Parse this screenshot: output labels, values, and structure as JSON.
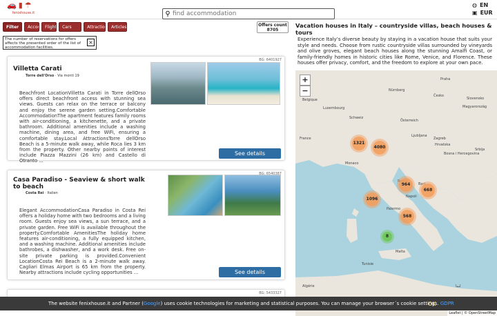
{
  "header": {
    "site_name": "fenixhouse.it",
    "search_placeholder": "find accommodation",
    "lang": "EN",
    "currency": "EUR"
  },
  "filters": [
    "Filter",
    "Accom",
    "Flights",
    "Cars",
    "Attractions",
    "Articles"
  ],
  "offers_count": {
    "label": "Offers count",
    "value": "8705"
  },
  "notice": {
    "text": "The number of reservations for offers affects the presented order of the list of accommodation facilities.",
    "close": "×"
  },
  "listings": [
    {
      "code": "BG: 6401927",
      "title": "Villetta Carati",
      "loc_name": "Torre dell'Orso",
      "loc_addr": "Via monti 19",
      "description": "Beachfront LocationVilletta Carati in Torre dellOrso offers direct beachfront access with stunning sea views. Guests can relax on the terrace or balcony and enjoy the serene garden setting.Comfortable AccommodationThe apartment features family rooms with air-conditioning, a kitchenette, and a private bathroom. Additional amenities include a washing machine, dining area, and free WiFi, ensuring a comfortable stay.Local AttractionsTorre dellOrso Beach is a 5-minute walk away, while Roca lies 3 km from the property. Other nearby points of interest include Piazza Mazzini (26 km) and Castello di Otranto ...",
      "button": "See details"
    },
    {
      "code": "BG: 6540387",
      "title": "Casa Paradiso - Seaview & short walk to beach",
      "loc_name": "Costa Rei",
      "loc_addr": "Italien",
      "description": "Elegant AccommodationCasa Paradiso in Costa Rei offers a holiday home with two bedrooms and a living room. Guests enjoy sea views, a sun terrace, and a private garden. Free WiFi is available throughout the property.Comfortable AmenitiesThe holiday home features air-conditioning, a fully equipped kitchen, and a washing machine. Additional amenities include bathrobes, a dishwasher, and a work desk. Free on-site private parking is provided.Convenient LocationCosta Rei Beach is a 2-minute walk away. Cagliari Elmas Airport is 65 km from the property. Nearby attractions include cycling opportunities ...",
      "button": "See details"
    },
    {
      "code": "BG: 5433327"
    }
  ],
  "right_panel": {
    "title": "Vacation houses in Italy – countryside villas, beach houses & tours",
    "description": "Experience Italy’s diverse beauty by staying in a vacation house that suits your style and needs. Choose from rustic countryside villas surrounded by vineyards and olive groves, elegant beach houses along the stunning Amalfi Coast, or family-friendly homes in historic cities like Rome, Venice, and Florence. These houses offer privacy, comfort, and the freedom to explore at your own pace."
  },
  "map": {
    "zoom_in": "+",
    "zoom_out": "−",
    "clusters": [
      "1321",
      "4080",
      "964",
      "668",
      "1096",
      "568",
      "8"
    ],
    "labels": [
      "Belgique",
      "Luxembourg",
      "Nürnberg",
      "Praha",
      "Česko",
      "Slovensko",
      "Magyarország",
      "Schweiz",
      "Österreich",
      "Ljubljana",
      "Zagreb",
      "Hrvatska",
      "Bosna i Hercegovina",
      "Srbija",
      "France",
      "Monaco",
      "Roma",
      "Napoli",
      "Bari",
      "Palermo",
      "Malta",
      "Tunisie",
      "Algérie",
      "ليبيا"
    ],
    "attribution": "Leaflet | © OpenStreetMap"
  },
  "cookie": {
    "text_before": "The website fenixhouse.it and Partner (",
    "link1": "Google",
    "text_after": ") uses cookie technologies for marketing and statistical purposes. You can manage your browser´s cookie settings.",
    "link2": "GDPR",
    "ok": "OK"
  },
  "colors": {
    "filter_bg": "#9b2d2d",
    "button_bg": "#2e6da4",
    "cluster": "#f39c5a",
    "cluster_green": "#6ec75a"
  }
}
